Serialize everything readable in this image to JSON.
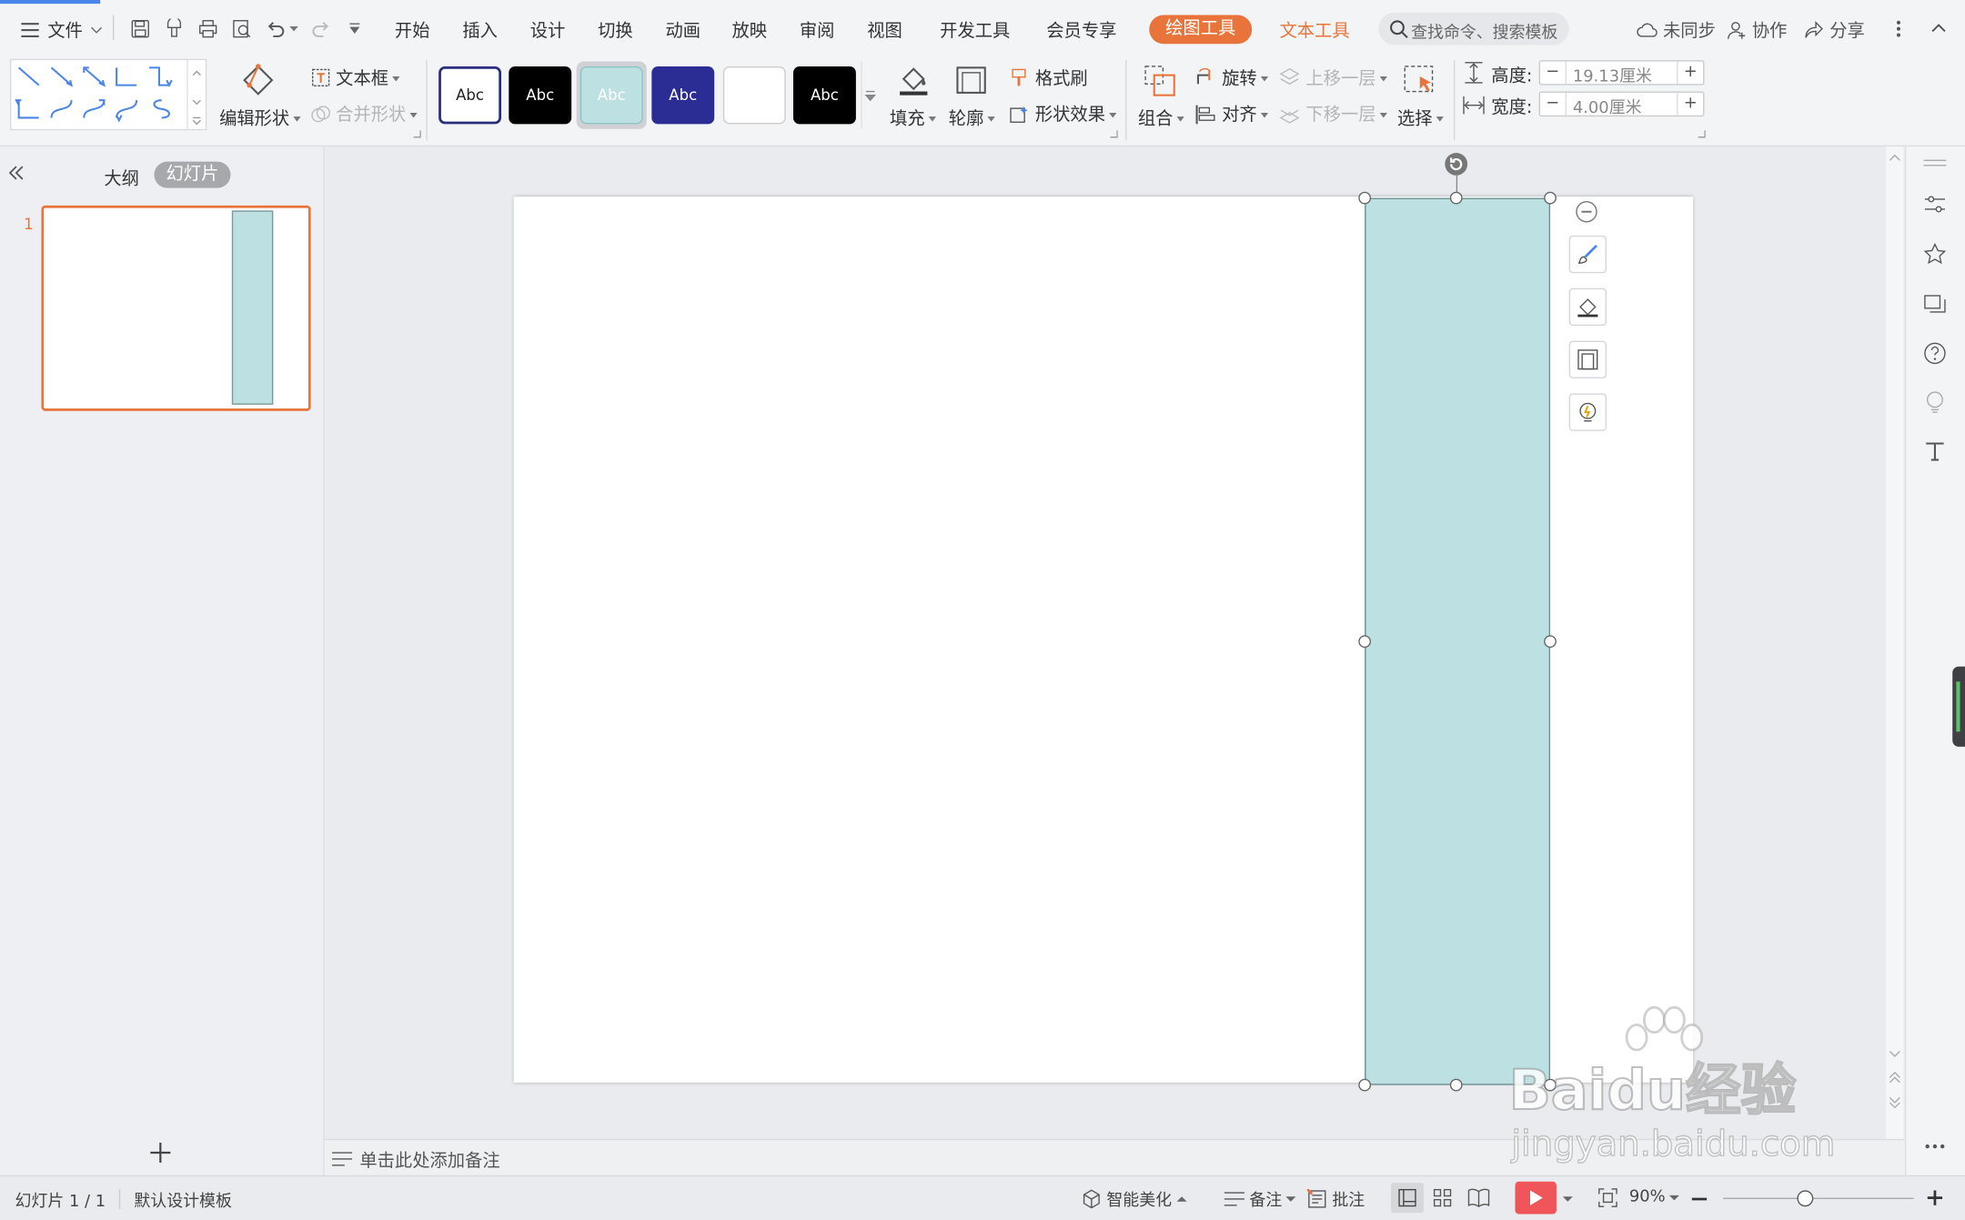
{
  "menu": {
    "file": "文件",
    "tabs": [
      "开始",
      "插入",
      "设计",
      "切换",
      "动画",
      "放映",
      "审阅",
      "视图",
      "开发工具",
      "会员专享"
    ],
    "active_tab": "绘图工具",
    "text_tools": "文本工具",
    "search_placeholder": "查找命令、搜索模板",
    "unsynced": "未同步",
    "collaborate": "协作",
    "share": "分享"
  },
  "ribbon": {
    "edit_shape": "编辑形状",
    "text_box": "文本框",
    "merge_shape": "合并形状",
    "style_samples": [
      "Abc",
      "Abc",
      "Abc",
      "Abc",
      "",
      "Abc"
    ],
    "fill": "填充",
    "outline": "轮廓",
    "format_painter": "格式刷",
    "shape_effects": "形状效果",
    "group": "组合",
    "rotate": "旋转",
    "align": "对齐",
    "bring_forward": "上移一层",
    "send_backward": "下移一层",
    "select": "选择",
    "height_label": "高度:",
    "height_value": "19.13厘米",
    "width_label": "宽度:",
    "width_value": "4.00厘米"
  },
  "sidebar": {
    "outline_tab": "大纲",
    "slides_tab": "幻灯片",
    "slide_number": "1"
  },
  "notes_placeholder": "单击此处添加备注",
  "status": {
    "slide_info": "幻灯片 1 / 1",
    "template": "默认设计模板",
    "smart_beautify": "智能美化",
    "notes": "备注",
    "comments": "批注",
    "zoom": "90%"
  },
  "watermark": {
    "brand": "Baidu经验",
    "url": "jingyan.baidu.com"
  },
  "colors": {
    "accent": "#e8743b",
    "shape_fill": "#bde0e2",
    "play_button": "#f0555a",
    "line_icon": "#4a86e8"
  }
}
